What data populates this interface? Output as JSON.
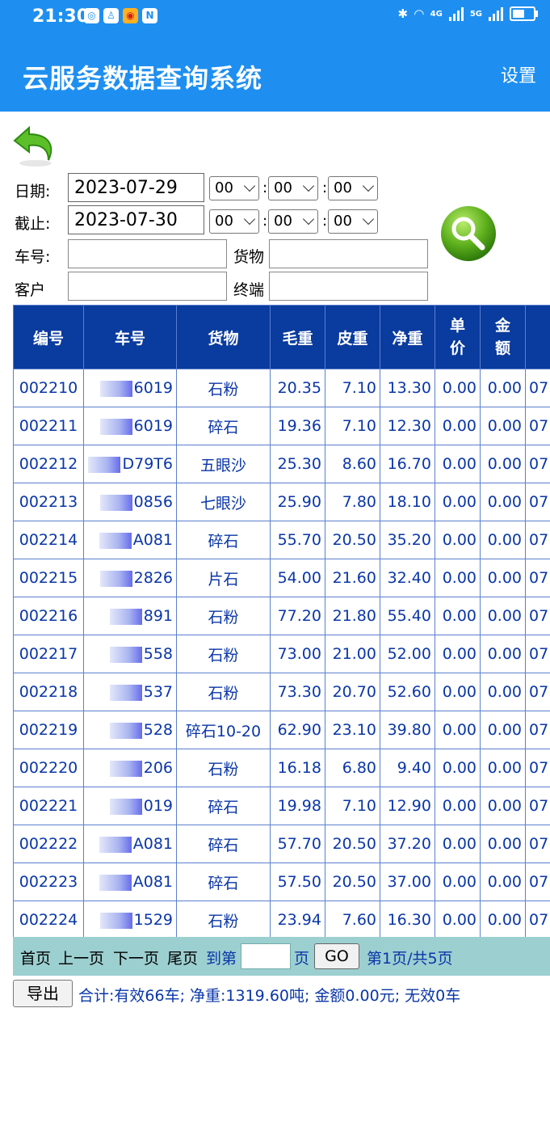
{
  "status_bar": {
    "time": "21:30",
    "icons": [
      "app-icon-1",
      "app-icon-2",
      "weibo-icon",
      "nfc-icon",
      "bluetooth-icon",
      "wifi-icon",
      "signal-icon",
      "signal-icon",
      "battery-icon"
    ],
    "net1": "4G",
    "net2": "5G"
  },
  "header": {
    "title": "云服务数据查询系统",
    "settings": "设置"
  },
  "filters": {
    "date_label": "日期:",
    "date_value": "2023-07-29",
    "end_label": "截止:",
    "end_value": "2023-07-30",
    "start_time": [
      "00",
      "00",
      "00"
    ],
    "end_time": [
      "00",
      "00",
      "00"
    ],
    "plate_label": "车号:",
    "goods_label": "货物",
    "customer_label": "客户",
    "terminal_label": "终端",
    "time_sep": ":"
  },
  "table": {
    "headers": [
      "编号",
      "车号",
      "货物",
      "毛重",
      "皮重",
      "净重",
      "单价",
      "金额",
      ""
    ],
    "rows": [
      [
        "002210",
        "6019",
        "石粉",
        "20.35",
        "7.10",
        "13.30",
        "0.00",
        "0.00",
        "07"
      ],
      [
        "002211",
        "6019",
        "碎石",
        "19.36",
        "7.10",
        "12.30",
        "0.00",
        "0.00",
        "07"
      ],
      [
        "002212",
        "D79T6",
        "五眼沙",
        "25.30",
        "8.60",
        "16.70",
        "0.00",
        "0.00",
        "07"
      ],
      [
        "002213",
        "0856",
        "七眼沙",
        "25.90",
        "7.80",
        "18.10",
        "0.00",
        "0.00",
        "07"
      ],
      [
        "002214",
        "A081",
        "碎石",
        "55.70",
        "20.50",
        "35.20",
        "0.00",
        "0.00",
        "07"
      ],
      [
        "002215",
        "2826",
        "片石",
        "54.00",
        "21.60",
        "32.40",
        "0.00",
        "0.00",
        "07"
      ],
      [
        "002216",
        "891",
        "石粉",
        "77.20",
        "21.80",
        "55.40",
        "0.00",
        "0.00",
        "07"
      ],
      [
        "002217",
        "558",
        "石粉",
        "73.00",
        "21.00",
        "52.00",
        "0.00",
        "0.00",
        "07"
      ],
      [
        "002218",
        "537",
        "石粉",
        "73.30",
        "20.70",
        "52.60",
        "0.00",
        "0.00",
        "07"
      ],
      [
        "002219",
        "528",
        "碎石10-20",
        "62.90",
        "23.10",
        "39.80",
        "0.00",
        "0.00",
        "07"
      ],
      [
        "002220",
        "206",
        "石粉",
        "16.18",
        "6.80",
        "9.40",
        "0.00",
        "0.00",
        "07"
      ],
      [
        "002221",
        "019",
        "碎石",
        "19.98",
        "7.10",
        "12.90",
        "0.00",
        "0.00",
        "07"
      ],
      [
        "002222",
        "A081",
        "碎石",
        "57.70",
        "20.50",
        "37.20",
        "0.00",
        "0.00",
        "07"
      ],
      [
        "002223",
        "A081",
        "碎石",
        "57.50",
        "20.50",
        "37.00",
        "0.00",
        "0.00",
        "07"
      ],
      [
        "002224",
        "1529",
        "石粉",
        "23.94",
        "7.60",
        "16.30",
        "0.00",
        "0.00",
        "07"
      ]
    ]
  },
  "pager": {
    "first": "首页",
    "prev": "上一页",
    "next": "下一页",
    "last": "尾页",
    "goto_label": "到第",
    "page_unit": "页",
    "go": "GO",
    "info": "第1页/共5页"
  },
  "footer": {
    "export": "导出",
    "summary": "合计:有效66车; 净重:1319.60吨; 金额0.00元; 无效0车"
  }
}
